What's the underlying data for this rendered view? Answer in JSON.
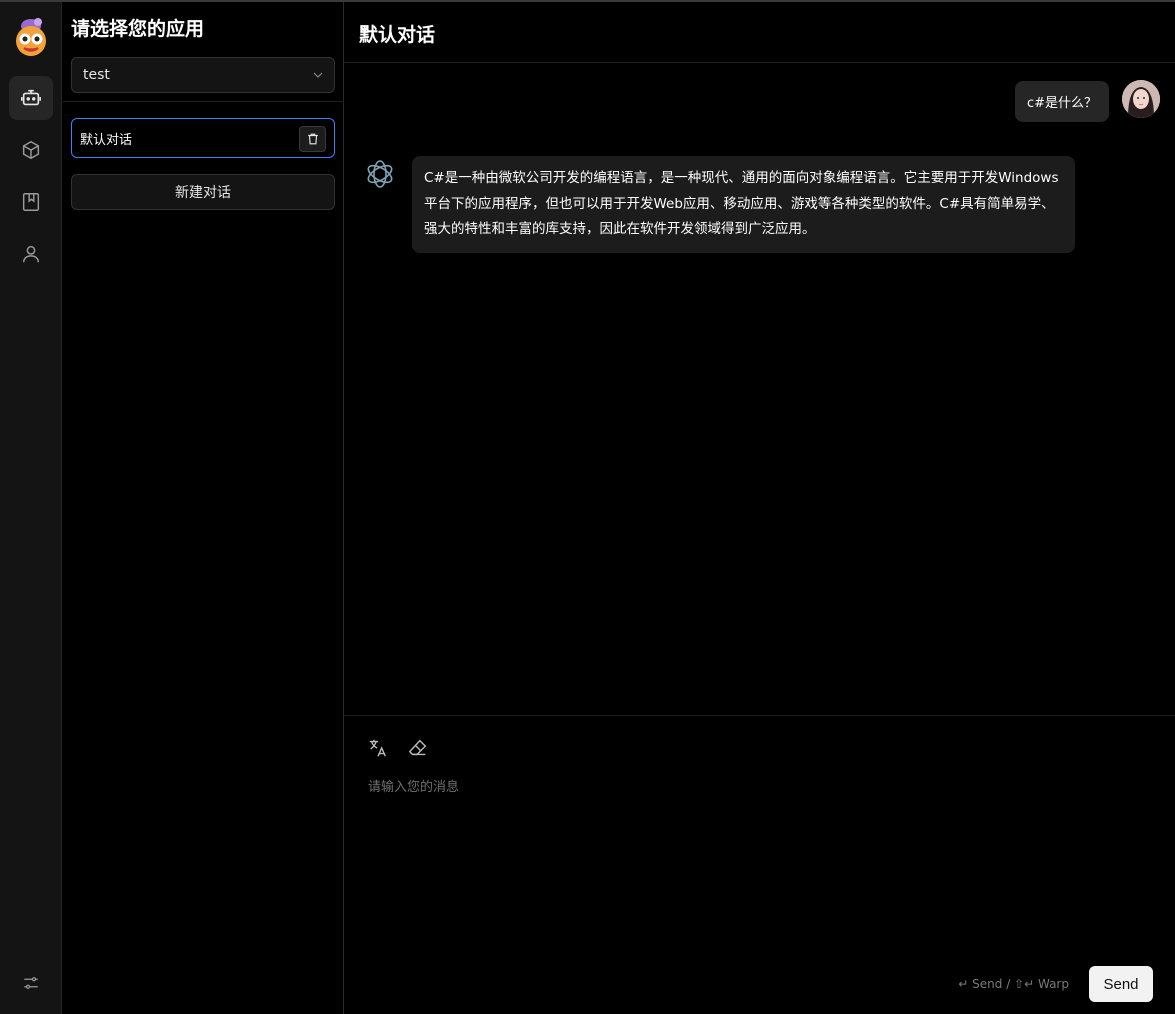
{
  "sidebar": {
    "nav": [
      {
        "icon": "robot-chat-icon",
        "active": true
      },
      {
        "icon": "cube-icon",
        "active": false
      },
      {
        "icon": "bookmark-book-icon",
        "active": false
      },
      {
        "icon": "user-icon",
        "active": false
      }
    ],
    "bottom_icon": "settings-sliders-icon"
  },
  "panel": {
    "title": "请选择您的应用",
    "app_select": {
      "value": "test"
    },
    "sessions": [
      {
        "label": "默认对话",
        "selected": true
      }
    ],
    "new_session_label": "新建对话"
  },
  "chat": {
    "title": "默认对话",
    "messages": [
      {
        "role": "user",
        "text": "c#是什么？"
      },
      {
        "role": "assistant",
        "text": "C#是一种由微软公司开发的编程语言，是一种现代、通用的面向对象编程语言。它主要用于开发Windows平台下的应用程序，但也可以用于开发Web应用、移动应用、游戏等各种类型的软件。C#具有简单易学、强大的特性和丰富的库支持，因此在软件开发领域得到广泛应用。"
      }
    ]
  },
  "composer": {
    "placeholder": "请输入您的消息",
    "hint": "↵ Send / ⇧↵ Warp",
    "send_label": "Send",
    "tools": [
      "translate-icon",
      "eraser-icon"
    ]
  },
  "colors": {
    "accent": "#3b82f6",
    "background": "#000000",
    "rail": "#141414",
    "bubble": "#1c1c1c"
  }
}
